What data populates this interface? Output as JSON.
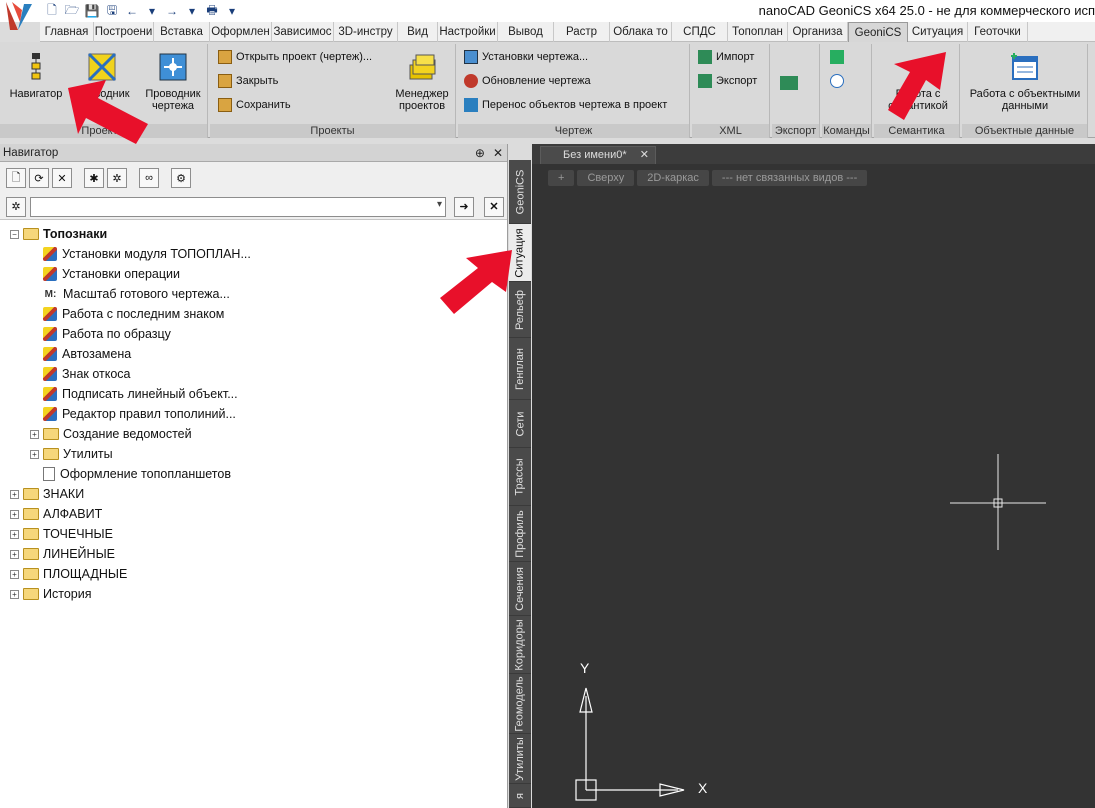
{
  "window": {
    "title": "nanoCAD GeoniCS x64 25.0 - не для коммерческого исп"
  },
  "ribbon_tabs": [
    {
      "label": "Главная",
      "w": 54
    },
    {
      "label": "Построени",
      "w": 60
    },
    {
      "label": "Вставка",
      "w": 56
    },
    {
      "label": "Оформлен",
      "w": 62
    },
    {
      "label": "Зависимос",
      "w": 62
    },
    {
      "label": "3D-инстру",
      "w": 64
    },
    {
      "label": "Вид",
      "w": 40
    },
    {
      "label": "Настройки",
      "w": 60
    },
    {
      "label": "Вывод",
      "w": 56
    },
    {
      "label": "Растр",
      "w": 56
    },
    {
      "label": "Облака то",
      "w": 62
    },
    {
      "label": "СПДС",
      "w": 56
    },
    {
      "label": "Топоплан",
      "w": 60
    },
    {
      "label": "Организа",
      "w": 60
    },
    {
      "label": "GeoniCS",
      "w": 60,
      "active": true
    },
    {
      "label": "Ситуация",
      "w": 60
    },
    {
      "label": "Геоточки",
      "w": 60
    }
  ],
  "ribbon": {
    "group1": {
      "label": "Проекты",
      "btn_navigator": "Навигатор",
      "btn_proj_line1": "Проводник",
      "btn_proj_line2": "чертежа",
      "btn_mid": "Проводник"
    },
    "group2": {
      "label": "Проекты",
      "open": "Открыть проект (чертеж)...",
      "close": "Закрыть",
      "save": "Сохранить",
      "manager_line1": "Менеджер",
      "manager_line2": "проектов"
    },
    "group3": {
      "label": "Чертеж",
      "settings": "Установки чертежа...",
      "update": "Обновление чертежа",
      "transfer": "Перенос объектов чертежа в проект"
    },
    "group4": {
      "label": "XML",
      "import": "Импорт",
      "export": "Экспорт"
    },
    "group5": {
      "label": "Экспорт"
    },
    "group6": {
      "label": "Команды"
    },
    "group7": {
      "label": "Семантика",
      "btn_line1": "Работа с",
      "btn_line2": "семантикой"
    },
    "group8": {
      "label": "Объектные данные",
      "btn_line1": "Работа с объектными",
      "btn_line2": "данными"
    }
  },
  "navigator": {
    "title": "Навигатор",
    "tree": [
      {
        "label": "Топознаки",
        "level": 0,
        "exp": "−",
        "icon": "folder",
        "bold": true
      },
      {
        "label": "Установки модуля ТОПОПЛАН...",
        "level": 1,
        "icon": "cmd"
      },
      {
        "label": "Установки операции",
        "level": 1,
        "icon": "cmd"
      },
      {
        "label": "Масштаб готового чертежа...",
        "level": 1,
        "icon": "scale"
      },
      {
        "label": "Работа с последним знаком",
        "level": 1,
        "icon": "cmd"
      },
      {
        "label": "Работа по образцу",
        "level": 1,
        "icon": "cmd"
      },
      {
        "label": "Автозамена",
        "level": 1,
        "icon": "cmd"
      },
      {
        "label": "Знак откоса",
        "level": 1,
        "icon": "cmd"
      },
      {
        "label": "Подписать линейный объект...",
        "level": 1,
        "icon": "cmd"
      },
      {
        "label": "Редактор правил тополиний...",
        "level": 1,
        "icon": "cmd"
      },
      {
        "label": "Создание ведомостей",
        "level": 1,
        "exp": "+",
        "icon": "folder"
      },
      {
        "label": "Утилиты",
        "level": 1,
        "exp": "+",
        "icon": "folder"
      },
      {
        "label": "Оформление топопланшетов",
        "level": 1,
        "icon": "page"
      },
      {
        "label": "ЗНАКИ",
        "level": 0,
        "exp": "+",
        "icon": "folder"
      },
      {
        "label": "АЛФАВИТ",
        "level": 0,
        "exp": "+",
        "icon": "folder"
      },
      {
        "label": "ТОЧЕЧНЫЕ",
        "level": 0,
        "exp": "+",
        "icon": "folder"
      },
      {
        "label": "ЛИНЕЙНЫЕ",
        "level": 0,
        "exp": "+",
        "icon": "folder"
      },
      {
        "label": "ПЛОЩАДНЫЕ",
        "level": 0,
        "exp": "+",
        "icon": "folder"
      },
      {
        "label": "История",
        "level": 0,
        "exp": "+",
        "icon": "folder"
      }
    ]
  },
  "vertical_tabs": [
    {
      "label": "GeoniCS",
      "h": 64
    },
    {
      "label": "Ситуация",
      "h": 58,
      "active": true
    },
    {
      "label": "Рельеф",
      "h": 56
    },
    {
      "label": "Генплан",
      "h": 62
    },
    {
      "label": "Сети",
      "h": 48
    },
    {
      "label": "Трассы",
      "h": 58
    },
    {
      "label": "Профиль",
      "h": 56
    },
    {
      "label": "Сечения",
      "h": 54
    },
    {
      "label": "Коридоры",
      "h": 58
    },
    {
      "label": "Геомодель",
      "h": 60
    },
    {
      "label": "Утилиты",
      "h": 50
    },
    {
      "label": "я",
      "h": 24
    }
  ],
  "drawing": {
    "tab_label": "Без имени0*",
    "view_controls": [
      "+",
      "Сверху",
      "2D-каркас",
      "--- нет связанных видов ---"
    ],
    "ucs_x": "X",
    "ucs_y": "Y"
  }
}
